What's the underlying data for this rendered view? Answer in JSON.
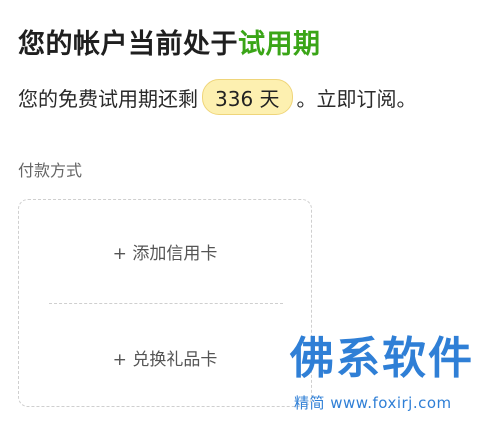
{
  "header": {
    "title_prefix": "您的帐户当前处于",
    "title_accent": "试用期"
  },
  "trial": {
    "text_before": "您的免费试用期还剩",
    "days_badge": "336 天",
    "text_after": "。立即订阅。"
  },
  "payment": {
    "section_label": "付款方式",
    "add_card_label": "+ 添加信用卡",
    "redeem_gift_label": "+ 兑换礼品卡"
  },
  "watermark": {
    "main": "佛系软件",
    "sub": "精简 www.foxirj.com"
  },
  "colors": {
    "accent_green": "#3aa517",
    "badge_bg": "#fdf0b0",
    "watermark_blue": "#2f7fd6"
  }
}
